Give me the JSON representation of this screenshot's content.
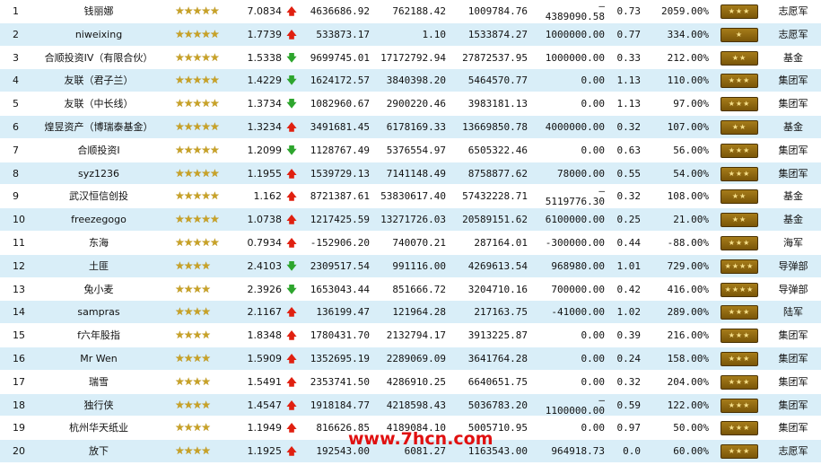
{
  "rows": [
    {
      "rank": "1",
      "name": "钱丽娜",
      "stars": "★★★★★",
      "score": "7.0834",
      "trend": "up",
      "v1": "4636686.92",
      "v2": "762188.42",
      "v3": "1009784.76",
      "v4a": "–",
      "v4b": "4389090.58",
      "ratio": "0.73",
      "pct": "2059.00%",
      "badge": "★★★",
      "type": "志愿军"
    },
    {
      "rank": "2",
      "name": "niweixing",
      "stars": "★★★★★",
      "score": "1.7739",
      "trend": "up",
      "v1": "533873.17",
      "v2": "1.10",
      "v3": "1533874.27",
      "v4a": "1000000.00",
      "v4b": "",
      "ratio": "0.77",
      "pct": "334.00%",
      "badge": "★",
      "type": "志愿军"
    },
    {
      "rank": "3",
      "name": "合顺投资IV（有限合伙）",
      "stars": "★★★★★",
      "score": "1.5338",
      "trend": "down",
      "v1": "9699745.01",
      "v2": "17172792.94",
      "v3": "27872537.95",
      "v4a": "1000000.00",
      "v4b": "",
      "ratio": "0.33",
      "pct": "212.00%",
      "badge": "★★",
      "type": "基金"
    },
    {
      "rank": "4",
      "name": "友联（君子兰）",
      "stars": "★★★★★",
      "score": "1.4229",
      "trend": "down",
      "v1": "1624172.57",
      "v2": "3840398.20",
      "v3": "5464570.77",
      "v4a": "0.00",
      "v4b": "",
      "ratio": "1.13",
      "pct": "110.00%",
      "badge": "★★★",
      "type": "集团军"
    },
    {
      "rank": "5",
      "name": "友联（中长线）",
      "stars": "★★★★★",
      "score": "1.3734",
      "trend": "down",
      "v1": "1082960.67",
      "v2": "2900220.46",
      "v3": "3983181.13",
      "v4a": "0.00",
      "v4b": "",
      "ratio": "1.13",
      "pct": "97.00%",
      "badge": "★★★",
      "type": "集团军"
    },
    {
      "rank": "6",
      "name": "煌昱资产（博瑞泰基金）",
      "stars": "★★★★★",
      "score": "1.3234",
      "trend": "up",
      "v1": "3491681.45",
      "v2": "6178169.33",
      "v3": "13669850.78",
      "v4a": "4000000.00",
      "v4b": "",
      "ratio": "0.32",
      "pct": "107.00%",
      "badge": "★★",
      "type": "基金"
    },
    {
      "rank": "7",
      "name": "合顺投资I",
      "stars": "★★★★★",
      "score": "1.2099",
      "trend": "down",
      "v1": "1128767.49",
      "v2": "5376554.97",
      "v3": "6505322.46",
      "v4a": "0.00",
      "v4b": "",
      "ratio": "0.63",
      "pct": "56.00%",
      "badge": "★★★",
      "type": "集团军"
    },
    {
      "rank": "8",
      "name": "syz1236",
      "stars": "★★★★★",
      "score": "1.1955",
      "trend": "up",
      "v1": "1539729.13",
      "v2": "7141148.49",
      "v3": "8758877.62",
      "v4a": "78000.00",
      "v4b": "",
      "ratio": "0.55",
      "pct": "54.00%",
      "badge": "★★★",
      "type": "集团军"
    },
    {
      "rank": "9",
      "name": "武汉恒信创投",
      "stars": "★★★★★",
      "score": "1.162",
      "trend": "up",
      "v1": "8721387.61",
      "v2": "53830617.40",
      "v3": "57432228.71",
      "v4a": "–",
      "v4b": "5119776.30",
      "ratio": "0.32",
      "pct": "108.00%",
      "badge": "★★",
      "type": "基金"
    },
    {
      "rank": "10",
      "name": "freezegogo",
      "stars": "★★★★★",
      "score": "1.0738",
      "trend": "up",
      "v1": "1217425.59",
      "v2": "13271726.03",
      "v3": "20589151.62",
      "v4a": "6100000.00",
      "v4b": "",
      "ratio": "0.25",
      "pct": "21.00%",
      "badge": "★★",
      "type": "基金"
    },
    {
      "rank": "11",
      "name": "东海",
      "stars": "★★★★★",
      "score": "0.7934",
      "trend": "up",
      "v1": "-152906.20",
      "v2": "740070.21",
      "v3": "287164.01",
      "v4a": "-300000.00",
      "v4b": "",
      "ratio": "0.44",
      "pct": "-88.00%",
      "badge": "★★★",
      "type": "海军"
    },
    {
      "rank": "12",
      "name": "土匪",
      "stars": "★★★★",
      "score": "2.4103",
      "trend": "down",
      "v1": "2309517.54",
      "v2": "991116.00",
      "v3": "4269613.54",
      "v4a": "968980.00",
      "v4b": "",
      "ratio": "1.01",
      "pct": "729.00%",
      "badge": "★★★★",
      "type": "导弹部"
    },
    {
      "rank": "13",
      "name": "兔小麦",
      "stars": "★★★★",
      "score": "2.3926",
      "trend": "down",
      "v1": "1653043.44",
      "v2": "851666.72",
      "v3": "3204710.16",
      "v4a": "700000.00",
      "v4b": "",
      "ratio": "0.42",
      "pct": "416.00%",
      "badge": "★★★★",
      "type": "导弹部"
    },
    {
      "rank": "14",
      "name": "sampras",
      "stars": "★★★★",
      "score": "2.1167",
      "trend": "up",
      "v1": "136199.47",
      "v2": "121964.28",
      "v3": "217163.75",
      "v4a": "-41000.00",
      "v4b": "",
      "ratio": "1.02",
      "pct": "289.00%",
      "badge": "★★★",
      "type": "陆军"
    },
    {
      "rank": "15",
      "name": "f六年股指",
      "stars": "★★★★",
      "score": "1.8348",
      "trend": "up",
      "v1": "1780431.70",
      "v2": "2132794.17",
      "v3": "3913225.87",
      "v4a": "0.00",
      "v4b": "",
      "ratio": "0.39",
      "pct": "216.00%",
      "badge": "★★★",
      "type": "集团军"
    },
    {
      "rank": "16",
      "name": "Mr Wen",
      "stars": "★★★★",
      "score": "1.5909",
      "trend": "up",
      "v1": "1352695.19",
      "v2": "2289069.09",
      "v3": "3641764.28",
      "v4a": "0.00",
      "v4b": "",
      "ratio": "0.24",
      "pct": "158.00%",
      "badge": "★★★",
      "type": "集团军"
    },
    {
      "rank": "17",
      "name": "瑞雪",
      "stars": "★★★★",
      "score": "1.5491",
      "trend": "up",
      "v1": "2353741.50",
      "v2": "4286910.25",
      "v3": "6640651.75",
      "v4a": "0.00",
      "v4b": "",
      "ratio": "0.32",
      "pct": "204.00%",
      "badge": "★★★",
      "type": "集团军"
    },
    {
      "rank": "18",
      "name": "独行侠",
      "stars": "★★★★",
      "score": "1.4547",
      "trend": "up",
      "v1": "1918184.77",
      "v2": "4218598.43",
      "v3": "5036783.20",
      "v4a": "–",
      "v4b": "1100000.00",
      "ratio": "0.59",
      "pct": "122.00%",
      "badge": "★★★",
      "type": "集团军"
    },
    {
      "rank": "19",
      "name": "杭州华天纸业",
      "stars": "★★★★",
      "score": "1.1949",
      "trend": "up",
      "v1": "816626.85",
      "v2": "4189084.10",
      "v3": "5005710.95",
      "v4a": "0.00",
      "v4b": "",
      "ratio": "0.97",
      "pct": "50.00%",
      "badge": "★★★",
      "type": "集团军"
    },
    {
      "rank": "20",
      "name": "放下",
      "stars": "★★★★",
      "score": "1.1925",
      "trend": "up",
      "v1": "192543.00",
      "v2": "6081.27",
      "v3": "1163543.00",
      "v4a": "964918.73",
      "v4b": "",
      "ratio": "0.0",
      "pct": "60.00%",
      "badge": "★★★",
      "type": "志愿军"
    }
  ],
  "arrows": {
    "up": "🡅",
    "down": "🡇"
  },
  "colors": {
    "odd": "#ffffff",
    "even": "#d9eef8",
    "up": "#e02010",
    "down": "#2da52d"
  },
  "watermark": "www.7hcn.com"
}
